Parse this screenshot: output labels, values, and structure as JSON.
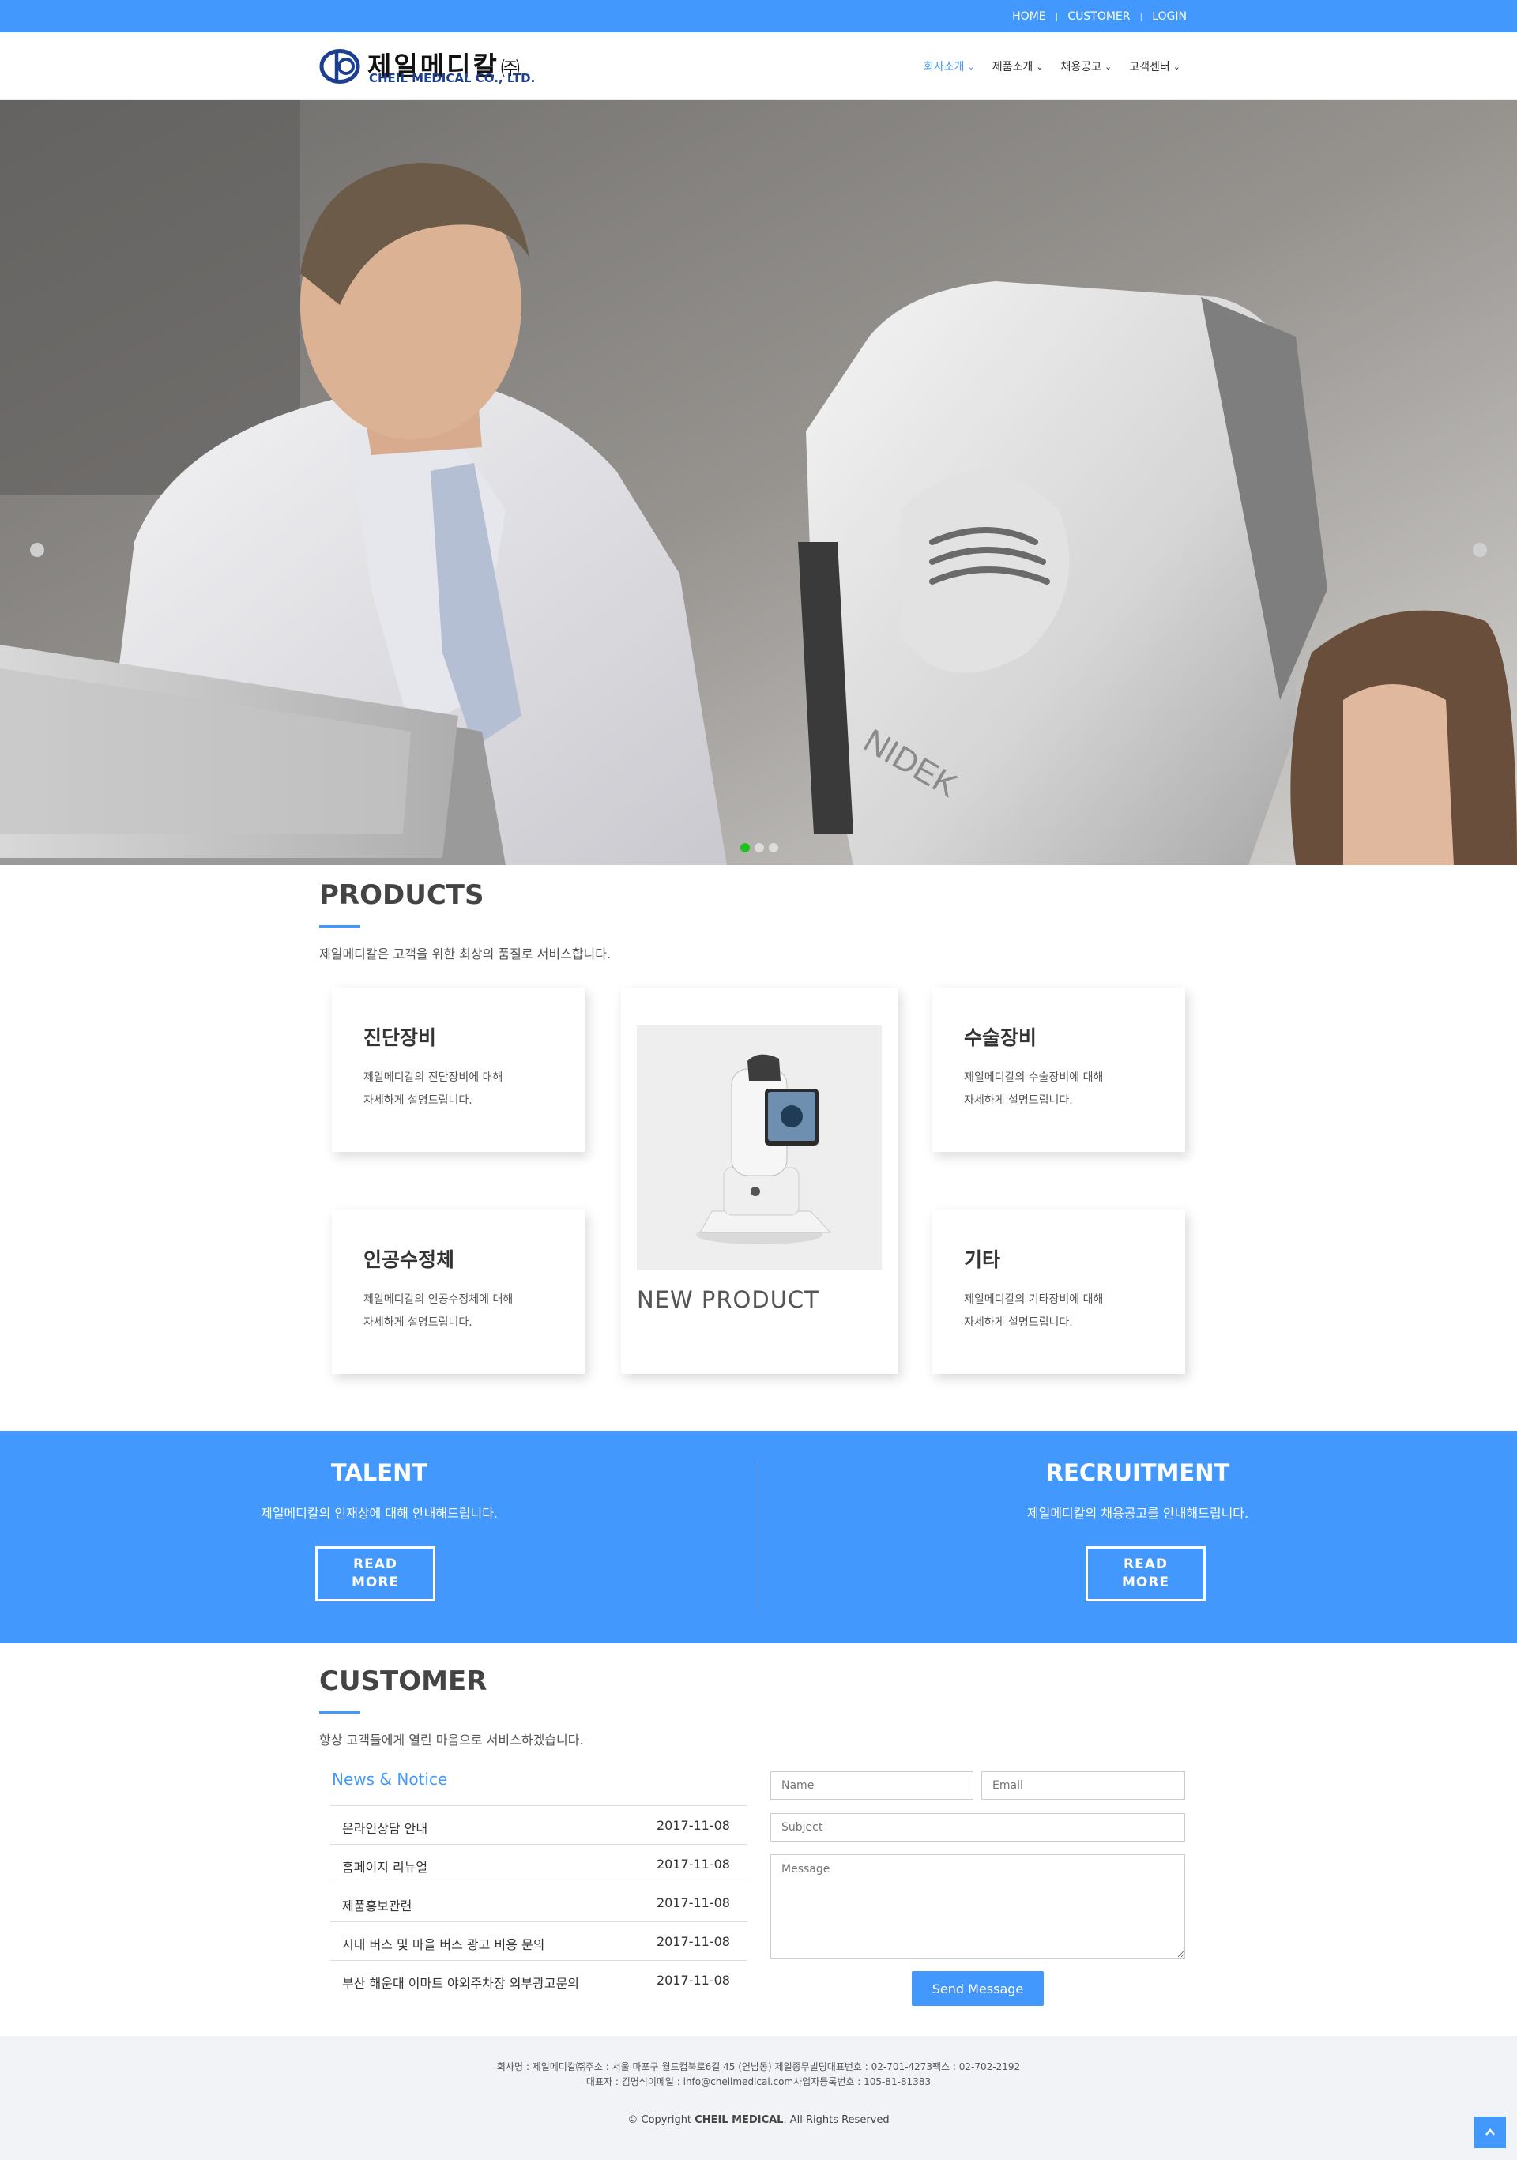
{
  "topbar": {
    "links": [
      "HOME",
      "CUSTOMER",
      "LOGIN"
    ]
  },
  "logo": {
    "korean": "제일메디칼",
    "korean_suffix": "㈜",
    "english": "CHEIL MEDICAL CO., LTD."
  },
  "nav": {
    "items": [
      {
        "label": "회사소개",
        "active": true
      },
      {
        "label": "제품소개",
        "active": false
      },
      {
        "label": "채용공고",
        "active": false
      },
      {
        "label": "고객센터",
        "active": false
      }
    ]
  },
  "hero": {
    "slides": 3,
    "active_slide": 1,
    "device_brand": "NIDEK"
  },
  "products": {
    "title": "PRODUCTS",
    "subtitle": "제일메디칼은 고객을 위한 최상의 품질로 서비스합니다.",
    "cards": [
      {
        "title": "진단장비",
        "line1": "제일메디칼의 진단장비에 대해",
        "line2": "자세하게 설명드립니다."
      },
      {
        "title": "수술장비",
        "line1": "제일메디칼의 수술장비에 대해",
        "line2": "자세하게 설명드립니다."
      },
      {
        "title": "인공수정체",
        "line1": "제일메디칼의 인공수정체에 대해",
        "line2": "자세하게 설명드립니다."
      },
      {
        "title": "기타",
        "line1": "제일메디칼의 기타장비에 대해",
        "line2": "자세하게 설명드립니다."
      }
    ],
    "new_product": {
      "label": "NEW PRODUCT"
    }
  },
  "banners": [
    {
      "title": "TALENT",
      "text": "제일메디칼의 인재상에 대해 안내해드립니다.",
      "button": {
        "line1": "READ",
        "line2": "MORE"
      }
    },
    {
      "title": "RECRUITMENT",
      "text": "제일메디칼의 채용공고를 안내해드립니다.",
      "button": {
        "line1": "READ",
        "line2": "MORE"
      }
    }
  ],
  "customer": {
    "title": "CUSTOMER",
    "subtitle": "항상 고객들에게 열린 마음으로 서비스하겠습니다.",
    "notice_title": "News & Notice",
    "news": [
      {
        "title": "온라인상담 안내",
        "date": "2017-11-08"
      },
      {
        "title": "홈페이지 리뉴얼",
        "date": "2017-11-08"
      },
      {
        "title": "제품홍보관련",
        "date": "2017-11-08"
      },
      {
        "title": "시내 버스 및 마을 버스 광고 비용 문의",
        "date": "2017-11-08"
      },
      {
        "title": "부산 해운대 이마트 야외주차장 외부광고문의",
        "date": "2017-11-08"
      }
    ],
    "form": {
      "name_placeholder": "Name",
      "email_placeholder": "Email",
      "subject_placeholder": "Subject",
      "message_placeholder": "Message",
      "send_label": "Send Message"
    }
  },
  "footer": {
    "line1": "회사명 : 제일메디칼㈜주소 : 서울 마포구 월드컵북로6길 45 (연남동) 제일종무빌딩대표번호 : 02-701-4273팩스 : 02-702-2192",
    "line2": "대표자 : 김명식이메일 : info@cheilmedical.com사업자등록번호 : 105-81-81383",
    "copyright_prefix": "© Copyright",
    "copyright_company": "CHEIL MEDICAL",
    "copyright_suffix": ". All Rights Reserved"
  },
  "colors": {
    "accent": "#4298fc",
    "slider_active": "#20c020",
    "footer_bg": "#f1f3f6"
  },
  "icons": {
    "to_top": "chevron-up-icon",
    "nav_dropdown": "chevron-down-icon",
    "logo": "logo-circle-icon"
  }
}
